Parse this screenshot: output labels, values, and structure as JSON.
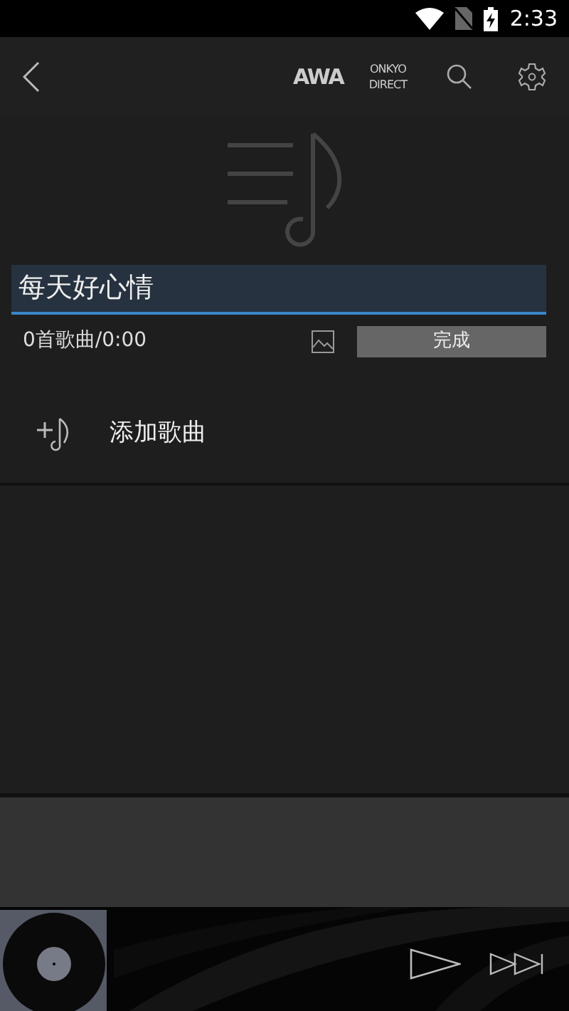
{
  "status_bar": {
    "time": "2:33"
  },
  "toolbar": {
    "brands": [
      {
        "kind": "awa",
        "lines": [
          "AWA"
        ]
      },
      {
        "kind": "onkyo",
        "lines": [
          "ONKYO",
          "DIRECT"
        ]
      }
    ]
  },
  "playlist": {
    "name": "每天好心情",
    "summary": "0首歌曲/0:00",
    "done_button": "完成"
  },
  "add_song": {
    "label": "添加歌曲"
  },
  "player": {
    "playing": false
  }
}
